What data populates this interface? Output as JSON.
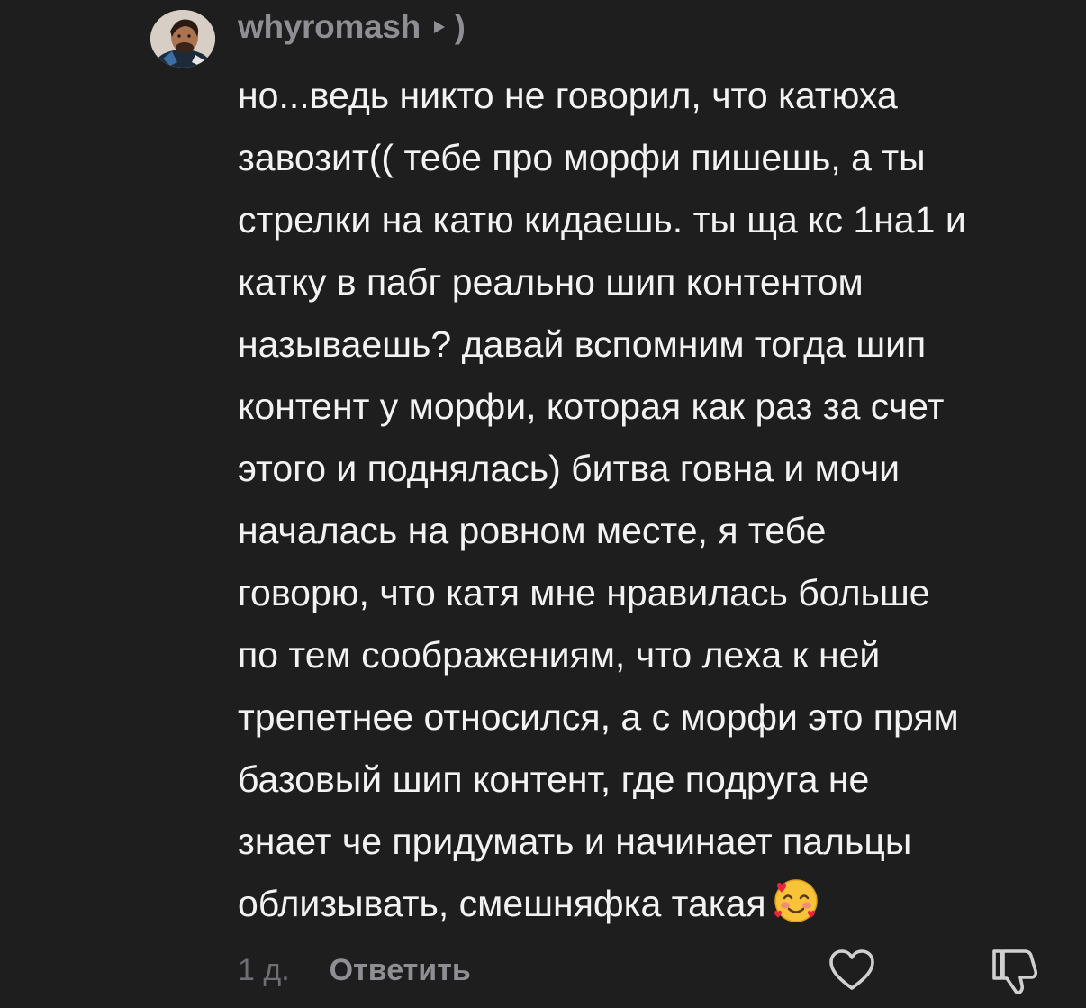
{
  "comment": {
    "username": "whyromash",
    "reply_target": ")",
    "lines": [
      "но...ведь никто не говорил, что катюха",
      "завозит(( тебе про морфи пишешь, а ты",
      "стрелки на катю кидаешь. ты ща кс 1на1 и",
      "катку в пабг реально шип контентом",
      "называешь? давай вспомним тогда шип",
      "контент у морфи, которая как раз за счет",
      "этого и поднялась) битва говна и мочи",
      "началась на ровном месте, я тебе",
      "говорю, что катя мне нравилась больше",
      "по тем соображениям, что леха к ней",
      "трепетнее относился, а с морфи это прям",
      "базовый шип контент, где подруга не",
      "знает че придумать и начинает пальцы",
      "облизывать, смешняфка такая"
    ],
    "emoji": "smiling-face-with-hearts-emoji",
    "time": "1 д.",
    "reply_label": "Ответить",
    "icons": {
      "like": "heart-icon",
      "dislike": "thumbs-down-icon",
      "reply_arrow": "play-triangle-icon"
    },
    "colors": {
      "background": "#1e1e1e",
      "text": "#f2f2f2",
      "muted": "#8e8e93",
      "time": "#6e6e73"
    }
  }
}
